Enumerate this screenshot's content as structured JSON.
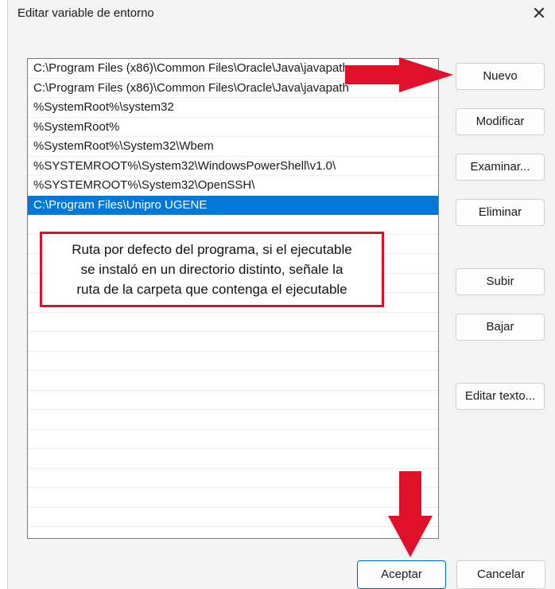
{
  "window": {
    "title": "Editar variable de entorno",
    "close_symbol": "✕"
  },
  "path_list": [
    "C:\\Program Files (x86)\\Common Files\\Oracle\\Java\\javapath",
    "C:\\Program Files (x86)\\Common Files\\Oracle\\Java\\javapath",
    "%SystemRoot%\\system32",
    "%SystemRoot%",
    "%SystemRoot%\\System32\\Wbem",
    "%SYSTEMROOT%\\System32\\WindowsPowerShell\\v1.0\\",
    "%SYSTEMROOT%\\System32\\OpenSSH\\",
    "C:\\Program Files\\Unipro UGENE"
  ],
  "selected_index": 7,
  "buttons": {
    "nuevo": "Nuevo",
    "modificar": "Modificar",
    "examinar": "Examinar...",
    "eliminar": "Eliminar",
    "subir": "Subir",
    "bajar": "Bajar",
    "editar_texto": "Editar texto...",
    "aceptar": "Aceptar",
    "cancelar": "Cancelar"
  },
  "annotation": {
    "lines": [
      "Ruta por defecto del programa, si el ejecutable",
      "se instaló en un directorio distinto, señale la",
      "ruta de la carpeta que contenga el ejecutable"
    ]
  },
  "colors": {
    "selection": "#0078d7",
    "annotation_red": "#e0102a"
  }
}
